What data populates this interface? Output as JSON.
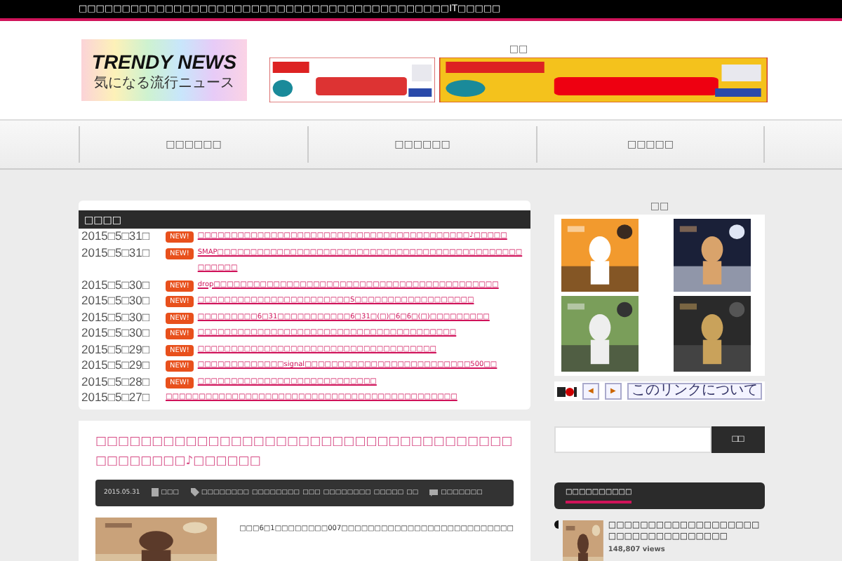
{
  "top_bar": {
    "text": "□□□□□□□□□□□□□□□□□□□□□□□□□□□□□□□□□□□□□□□□□□□IT□□□□□"
  },
  "header": {
    "logo_title": "TRENDY NEWS",
    "logo_subtitle": "気になる流行ニュース",
    "ad_label": "□□"
  },
  "nav": [
    {
      "label": "□□□□□□"
    },
    {
      "label": "□□□□□□"
    },
    {
      "label": "□□□□□"
    }
  ],
  "news": {
    "title": "□□□□",
    "items": [
      {
        "date": "2015□5□31□",
        "badge": "NEW!",
        "text": "□□□□□□□□□□□□□□□□□□□□□□□□□□□□□□□□□□□□□□□□□♪□□□□□"
      },
      {
        "date": "2015□5□31□",
        "badge": "NEW!",
        "text": "SMAP□□□□□□□□□□□□□□□□□□□□□□□□□□□□□□□□□□□□□□□□□□□□□□□□□□□□"
      },
      {
        "date": "2015□5□30□",
        "badge": "NEW!",
        "text": "drop□□□□□□□□□□□□□□□□□□□□□□□□□□□□□□□□□□□□□□□□□□□"
      },
      {
        "date": "2015□5□30□",
        "badge": "NEW!",
        "text": "□□□□□□□□□□□□□□□□□□□□□□□S□□□□□□□□□□□□□□□□□□"
      },
      {
        "date": "2015□5□30□",
        "badge": "NEW!",
        "text": "□□□□□□□□□6□31□□□□□□□□□□□6□31□(□)□6□6□(□)□□□□□□□□□"
      },
      {
        "date": "2015□5□30□",
        "badge": "NEW!",
        "text": "□□□□□□□□□□□□□□□□□□□□□□□□□□□□□□□□□□□□□□□"
      },
      {
        "date": "2015□5□29□",
        "badge": "NEW!",
        "text": "□□□□□□□□□□□□□□□□□□□□□□□□□□□□□□□□□□□□"
      },
      {
        "date": "2015□5□29□",
        "badge": "NEW!",
        "text": "□□□□□□□□□□□□□signal□□□□□□□□□□□□□□□□□□□□□□□□□500□□"
      },
      {
        "date": "2015□5□28□",
        "badge": "NEW!",
        "text": "□□□□□□□□□□□□□□□□□□□□□□□□□□□"
      },
      {
        "date": "2015□5□27□",
        "text": "□□□□□□□□□□□□□□□□□□□□□□□□□□□□□□□□□□□□□□□□□□□□"
      }
    ]
  },
  "post": {
    "title": "□□□□□□□□□□□□□□□□□□□□□□□□□□□□□□□□□□□□□□□□□□□□□♪□□□□□□",
    "date": "2015.05.31",
    "category": "□□□",
    "tags": [
      "□□□□□□□□",
      "□□□□□□□□",
      "□□□",
      "□□□□□□□□",
      "□□□□□",
      "□□"
    ],
    "comments": "□□□□□□□",
    "excerpt": "□□□6□1□□□□□□□□007□□□□□□□□□□□□□□□□□□□□□□□□□□"
  },
  "ad_widget": {
    "label": "□□",
    "prev": "◀",
    "next": "▶",
    "about": "このリンクについて"
  },
  "search": {
    "button": "□□"
  },
  "popular": {
    "title": "□□□□□□□□□□",
    "items": [
      {
        "title": "□□□□□□□□□□□□□□□□□□□□□□□□□□□□□□□□□□",
        "views": "148,807 views"
      }
    ]
  }
}
